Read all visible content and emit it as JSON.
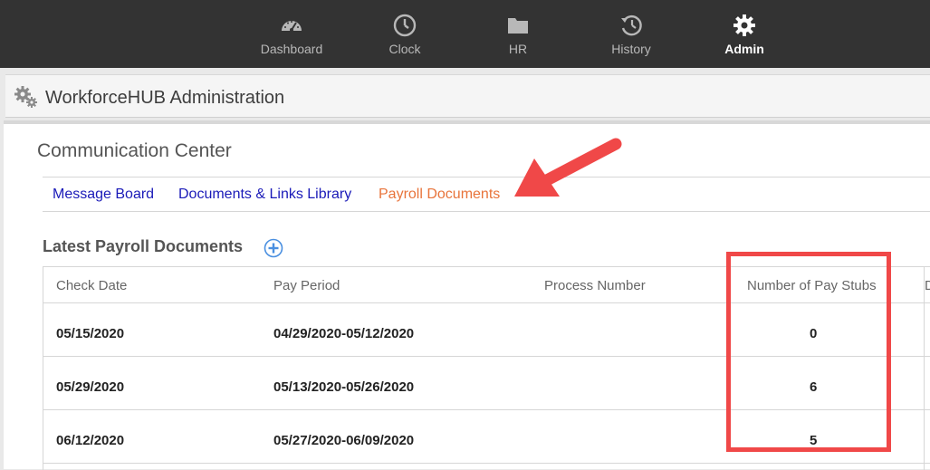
{
  "nav": {
    "items": [
      {
        "label": "Dashboard",
        "icon": "speedometer-icon",
        "active": false
      },
      {
        "label": "Clock",
        "icon": "clock-icon",
        "active": false
      },
      {
        "label": "HR",
        "icon": "folder-icon",
        "active": false
      },
      {
        "label": "History",
        "icon": "history-icon",
        "active": false
      },
      {
        "label": "Admin",
        "icon": "gear-icon",
        "active": true
      }
    ]
  },
  "header": {
    "title": "WorkforceHUB Administration",
    "icon": "gears-icon"
  },
  "main": {
    "title": "Communication Center",
    "tabs": [
      {
        "label": "Message Board",
        "active": false
      },
      {
        "label": "Documents & Links Library",
        "active": false
      },
      {
        "label": "Payroll Documents",
        "active": true
      }
    ],
    "section_title": "Latest Payroll Documents",
    "table": {
      "columns": [
        "Check Date",
        "Pay Period",
        "Process Number",
        "Number of Pay Stubs",
        "D"
      ],
      "rows": [
        {
          "check_date": "05/15/2020",
          "pay_period": "04/29/2020-05/12/2020",
          "process_number": "",
          "pay_stubs": "0"
        },
        {
          "check_date": "05/29/2020",
          "pay_period": "05/13/2020-05/26/2020",
          "process_number": "",
          "pay_stubs": "6"
        },
        {
          "check_date": "06/12/2020",
          "pay_period": "05/27/2020-06/09/2020",
          "process_number": "",
          "pay_stubs": "5"
        }
      ]
    }
  },
  "colors": {
    "nav_bg": "#333333",
    "active_tab": "#e8743b",
    "link": "#1a1ab8",
    "annotation": "#f04848",
    "add_button": "#4a8fe0"
  }
}
